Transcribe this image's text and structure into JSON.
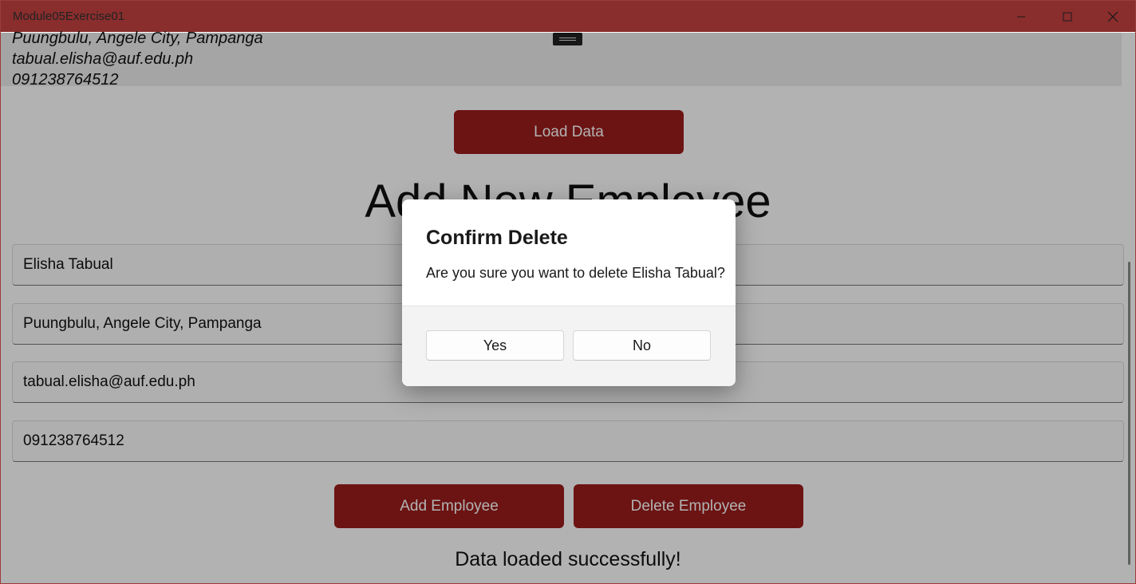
{
  "window": {
    "title": "Module05Exercise01",
    "accent_color": "#8a2d2d"
  },
  "record": {
    "address": "Puungbulu, Angele City, Pampanga",
    "email": "tabual.elisha@auf.edu.ph",
    "phone": "091238764512"
  },
  "actions": {
    "load_label": "Load Data",
    "add_label": "Add Employee",
    "delete_label": "Delete Employee",
    "button_color": "#9b1c1c"
  },
  "form": {
    "heading": "Add New Employee",
    "name_value": "Elisha Tabual",
    "address_value": "Puungbulu, Angele City, Pampanga",
    "email_value": "tabual.elisha@auf.edu.ph",
    "phone_value": "091238764512"
  },
  "status": {
    "message": "Data loaded successfully!"
  },
  "dialog": {
    "title": "Confirm Delete",
    "message": "Are you sure you want to delete Elisha Tabual?",
    "yes_label": "Yes",
    "no_label": "No"
  },
  "icons": {
    "minimize": "minimize-icon",
    "maximize": "maximize-icon",
    "close": "close-icon"
  }
}
